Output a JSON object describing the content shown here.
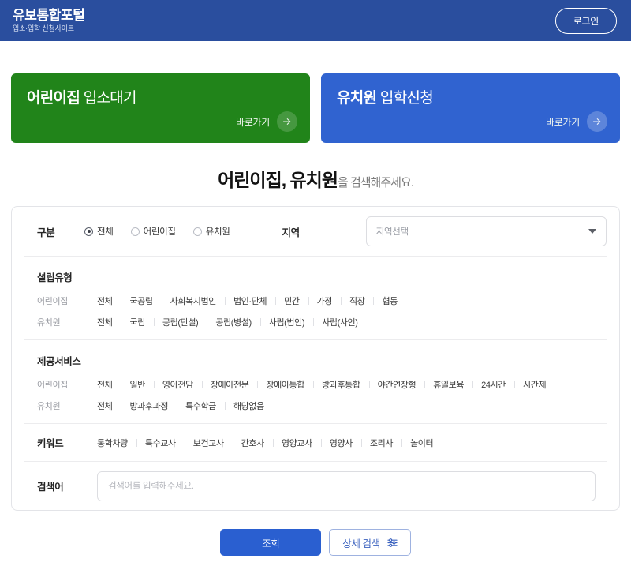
{
  "header": {
    "brand_title": "유보통합포털",
    "brand_subtitle": "입소·입학 신청사이트",
    "login_label": "로그인"
  },
  "cards": [
    {
      "title_strong": "어린이집",
      "title_light": " 입소대기",
      "link_label": "바로가기",
      "color": "#21841a"
    },
    {
      "title_strong": "유치원",
      "title_light": " 입학신청",
      "link_label": "바로가기",
      "color": "#3063d0"
    }
  ],
  "headline": {
    "strong": "어린이집, 유치원",
    "weak": "을 검색해주세요."
  },
  "search": {
    "gubun_label": "구분",
    "gubun_options": [
      {
        "label": "전체",
        "checked": true
      },
      {
        "label": "어린이집",
        "checked": false
      },
      {
        "label": "유치원",
        "checked": false
      }
    ],
    "region_label": "지역",
    "region_placeholder": "지역선택",
    "establishment": {
      "title": "설립유형",
      "rows": [
        {
          "label": "어린이집",
          "options": [
            "전체",
            "국공립",
            "사회복지법인",
            "법인·단체",
            "민간",
            "가정",
            "직장",
            "협동"
          ]
        },
        {
          "label": "유치원",
          "options": [
            "전체",
            "국립",
            "공립(단설)",
            "공립(병설)",
            "사립(법인)",
            "사립(사인)"
          ]
        }
      ]
    },
    "services": {
      "title": "제공서비스",
      "rows": [
        {
          "label": "어린이집",
          "options": [
            "전체",
            "일반",
            "영아전담",
            "장애아전문",
            "장애아통합",
            "방과후통합",
            "야간연장형",
            "휴일보육",
            "24시간",
            "시간제"
          ]
        },
        {
          "label": "유치원",
          "options": [
            "전체",
            "방과후과정",
            "특수학급",
            "해당없음"
          ]
        }
      ]
    },
    "keyword": {
      "title": "키워드",
      "options": [
        "통학차량",
        "특수교사",
        "보건교사",
        "간호사",
        "영양교사",
        "영양사",
        "조리사",
        "놀이터"
      ]
    },
    "term": {
      "label": "검색어",
      "placeholder": "검색어를 입력해주세요.",
      "value": ""
    }
  },
  "actions": {
    "submit_label": "조회",
    "detail_label": "상세 검색"
  }
}
